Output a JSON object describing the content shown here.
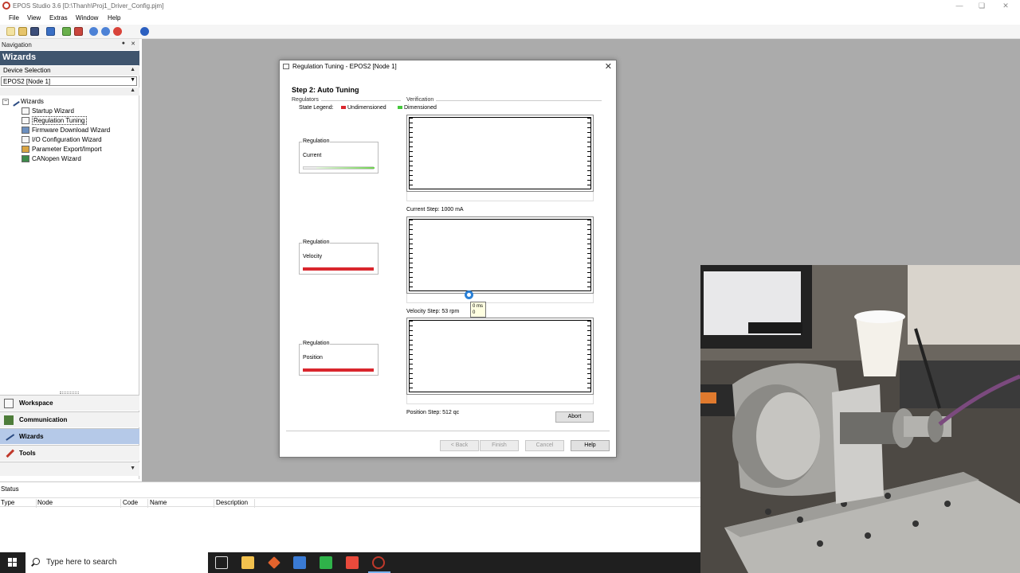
{
  "window": {
    "title": "EPOS Studio 3.6 [D:\\Thanh\\Proj1_Driver_Config.pjm]"
  },
  "menu": [
    "File",
    "View",
    "Extras",
    "Window",
    "Help"
  ],
  "navigation": {
    "header": "Navigation",
    "wizards_title": "Wizards",
    "device_selection_label": "Device Selection",
    "device_selected": "EPOS2 [Node 1]",
    "tree_root": "Wizards",
    "tree_items": [
      "Startup Wizard",
      "Regulation Tuning",
      "Firmware Download Wizard",
      "I/O Configuration Wizard",
      "Parameter Export/Import",
      "CANopen Wizard"
    ],
    "bottom_items": [
      "Workspace",
      "Communication",
      "Wizards",
      "Tools"
    ]
  },
  "dialog": {
    "title": "Regulation Tuning - EPOS2 [Node 1]",
    "step_title": "Step 2: Auto Tuning",
    "regulators_label": "Regulators",
    "verification_label": "Verification",
    "state_legend_label": "State Legend:",
    "legend": [
      {
        "label": "Undimensioned",
        "color": "#d9262d"
      },
      {
        "label": "Dimensioned",
        "color": "#45c83c"
      }
    ],
    "regulations": [
      {
        "group": "Regulation",
        "name": "Current",
        "state_color": "#6fd14f",
        "progress": 0.82,
        "step_label": "Current Step: 1000 mA"
      },
      {
        "group": "Regulation",
        "name": "Velocity",
        "state_color": "#d9262d",
        "progress": 1.0,
        "step_label": "Velocity Step: 53 rpm"
      },
      {
        "group": "Regulation",
        "name": "Position",
        "state_color": "#d9262d",
        "progress": 1.0,
        "step_label": "Position Step: 512 qc"
      }
    ],
    "tooltip": {
      "line1": "0 ms",
      "line2": "0"
    },
    "buttons": {
      "abort": "Abort",
      "back": "< Back",
      "finish": "Finish",
      "cancel": "Cancel",
      "help": "Help"
    }
  },
  "status": {
    "title": "Status",
    "columns": [
      "Type",
      "Node",
      "Code",
      "Name",
      "Description"
    ]
  },
  "taskbar": {
    "search_placeholder": "Type here to search"
  }
}
